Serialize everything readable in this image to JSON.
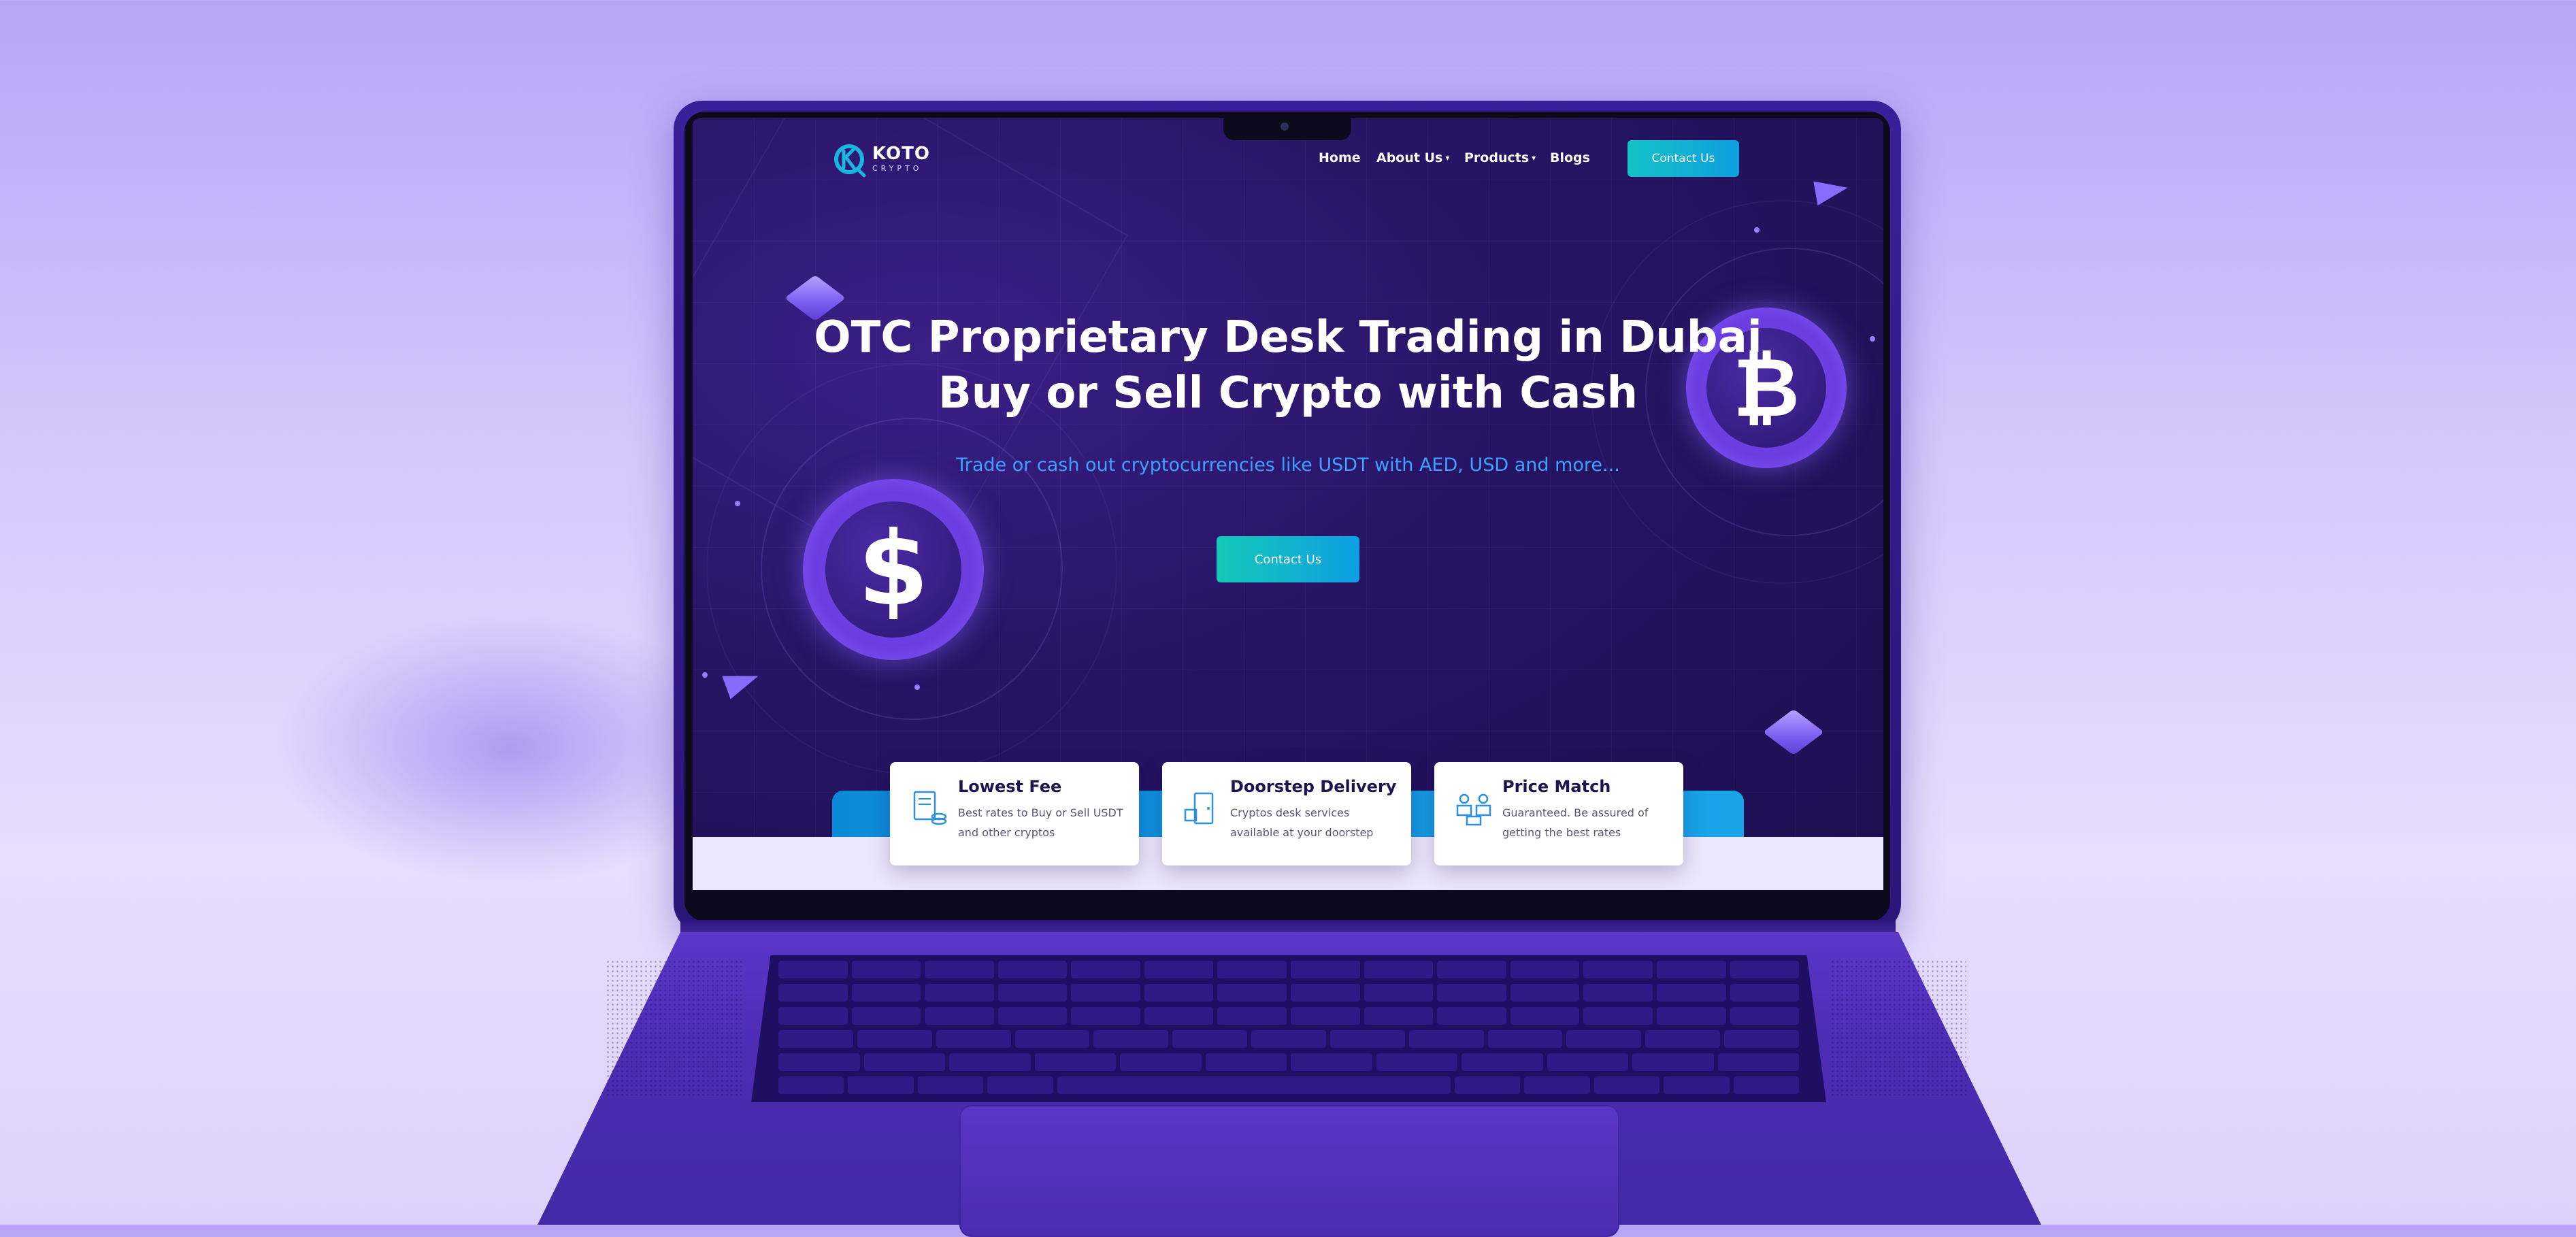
{
  "nav": {
    "logo_name": "KOTO",
    "logo_sub": "CRYPTO",
    "items": [
      "Home",
      "About Us",
      "Products",
      "Blogs"
    ],
    "cta": "Contact Us"
  },
  "hero": {
    "title_line1": "OTC Proprietary Desk Trading in Dubai",
    "title_line2": "Buy or Sell Crypto with Cash",
    "subtitle": "Trade or cash out cryptocurrencies like USDT with AED, USD and more...",
    "cta": "Contact Us"
  },
  "cards": [
    {
      "title": "Lowest Fee",
      "text": "Best rates to Buy or Sell USDT and other cryptos",
      "icon": "document-coins-icon"
    },
    {
      "title": "Doorstep Delivery",
      "text": "Cryptos desk services available at your doorstep",
      "icon": "door-delivery-icon"
    },
    {
      "title": "Price Match",
      "text": "Guaranteed. Be assured of getting the best rates",
      "icon": "people-match-icon"
    }
  ],
  "coins": {
    "dollar": "$",
    "bitcoin": "₿"
  },
  "colors": {
    "brand_teal": "#13c2c6",
    "brand_blue": "#0f9ee0",
    "hero_bg": "#261464",
    "subtitle": "#3ea0ff"
  }
}
